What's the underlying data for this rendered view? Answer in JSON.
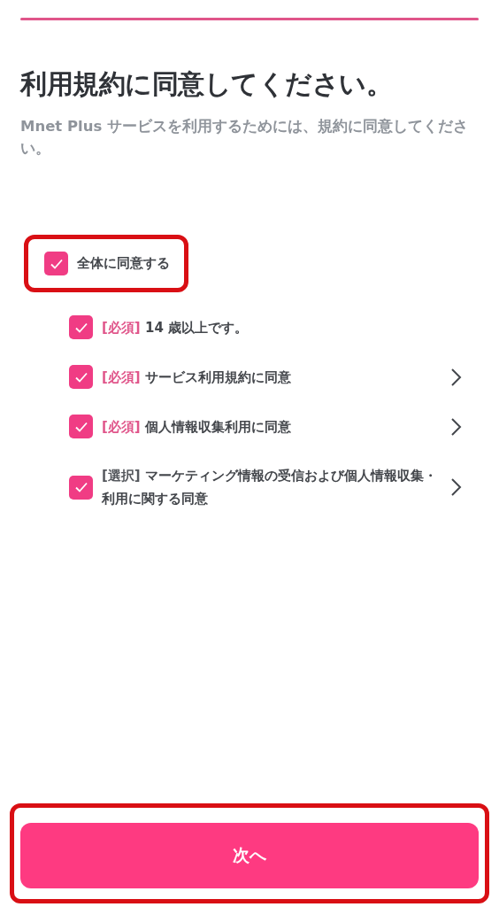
{
  "progress": {
    "level": 1
  },
  "title": "利用規約に同意してください。",
  "subtitle": "Mnet Plus サービスを利用するためには、規約に同意してください。",
  "agree_all": {
    "label": "全体に同意する",
    "checked": true,
    "highlighted": true
  },
  "terms": [
    {
      "tag": "[必須]",
      "required": true,
      "label": "14 歳以上です。",
      "checked": true,
      "has_detail": false
    },
    {
      "tag": "[必須]",
      "required": true,
      "label": "サービス利用規約に同意",
      "checked": true,
      "has_detail": true
    },
    {
      "tag": "[必須]",
      "required": true,
      "label": "個人情報収集利用に同意",
      "checked": true,
      "has_detail": true
    },
    {
      "tag": "[選択]",
      "required": false,
      "label": "マーケティング情報の受信および個人情報収集・利用に関する同意",
      "checked": true,
      "has_detail": true
    }
  ],
  "next_button": {
    "label": "次へ",
    "highlighted": true
  }
}
